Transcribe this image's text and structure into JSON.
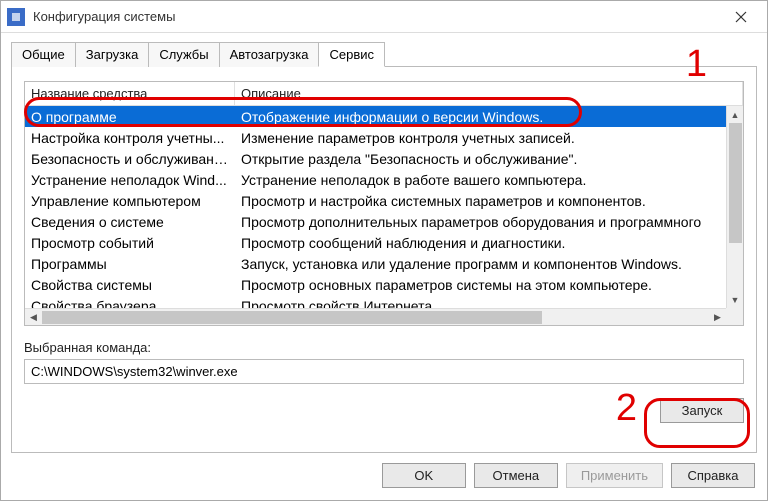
{
  "window": {
    "title": "Конфигурация системы"
  },
  "tabs": {
    "items": [
      {
        "label": "Общие"
      },
      {
        "label": "Загрузка"
      },
      {
        "label": "Службы"
      },
      {
        "label": "Автозагрузка"
      },
      {
        "label": "Сервис"
      }
    ],
    "active_index": 4
  },
  "columns": {
    "name": "Название средства",
    "desc": "Описание"
  },
  "rows": [
    {
      "name": "О программе",
      "desc": "Отображение информации о версии Windows.",
      "selected": true
    },
    {
      "name": "Настройка контроля учетны...",
      "desc": "Изменение параметров контроля учетных записей."
    },
    {
      "name": "Безопасность и обслуживание",
      "desc": "Открытие раздела \"Безопасность и обслуживание\"."
    },
    {
      "name": "Устранение неполадок Wind...",
      "desc": "Устранение неполадок в работе вашего компьютера."
    },
    {
      "name": "Управление компьютером",
      "desc": "Просмотр и настройка системных параметров и компонентов."
    },
    {
      "name": "Сведения о системе",
      "desc": "Просмотр дополнительных параметров оборудования и программного"
    },
    {
      "name": "Просмотр событий",
      "desc": "Просмотр сообщений наблюдения и диагностики."
    },
    {
      "name": "Программы",
      "desc": "Запуск, установка или удаление программ и компонентов Windows."
    },
    {
      "name": "Свойства системы",
      "desc": "Просмотр основных параметров системы на этом компьютере."
    },
    {
      "name": "Свойства браузера",
      "desc": "Просмотр свойств Интернета."
    }
  ],
  "selected_command": {
    "label": "Выбранная команда:",
    "value": "C:\\WINDOWS\\system32\\winver.exe"
  },
  "buttons": {
    "run": "Запуск",
    "ok": "OK",
    "cancel": "Отмена",
    "apply": "Применить",
    "help": "Справка"
  },
  "annotations": {
    "num1": "1",
    "num2": "2"
  }
}
